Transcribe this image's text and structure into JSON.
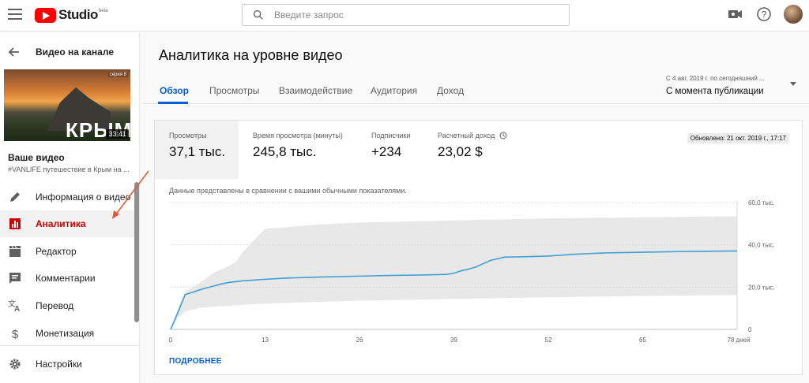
{
  "header": {
    "studio_word": "Studio",
    "beta": "beta",
    "search_placeholder": "Введите запрос",
    "icons": [
      "menu-icon",
      "youtube-logo",
      "search-icon",
      "create-video-icon",
      "help-icon",
      "avatar"
    ]
  },
  "sidebar": {
    "back_label": "Видео на канале",
    "thumbnail": {
      "series_tag": "серия 8",
      "overlay_text": "КРЫМ",
      "duration": "33:41"
    },
    "video_title": "Ваше видео",
    "video_subtitle": "#VANLIFE путешествие в Крым на ...",
    "items": [
      {
        "label": "Информация о видео",
        "icon": "pencil-icon"
      },
      {
        "label": "Аналитика",
        "icon": "analytics-icon",
        "active": true
      },
      {
        "label": "Редактор",
        "icon": "clapperboard-icon"
      },
      {
        "label": "Комментарии",
        "icon": "comment-icon"
      },
      {
        "label": "Перевод",
        "icon": "translate-icon"
      },
      {
        "label": "Монетизация",
        "icon": "dollar-icon"
      },
      {
        "label": "Настройки",
        "icon": "gear-icon"
      }
    ]
  },
  "main": {
    "title": "Аналитика на уровне видео",
    "tabs": [
      {
        "label": "Обзор",
        "active": true
      },
      {
        "label": "Просмотры"
      },
      {
        "label": "Взаимодействие"
      },
      {
        "label": "Аудитория"
      },
      {
        "label": "Доход"
      }
    ],
    "range_caption": "С 4 авг. 2019 г. по сегодняшний ...",
    "range_value": "С момента публикации",
    "metrics": [
      {
        "label": "Просмотры",
        "value": "37,1 тыс.",
        "selected": true
      },
      {
        "label": "Время просмотра (минуты)",
        "value": "245,8 тыс."
      },
      {
        "label": "Подписчики",
        "value": "+234"
      },
      {
        "label": "Расчетный доход",
        "value": "23,02 $",
        "info_icon": "info-icon"
      }
    ],
    "updated": "Обновлено: 21 окт. 2019 г., 17:17",
    "note": "Данные представлены в сравнении с вашими обычными показателями.",
    "more_link": "ПОДРОБНЕЕ"
  },
  "chart_data": {
    "type": "line",
    "x_ticks": [
      "0",
      "13",
      "26",
      "39",
      "52",
      "65",
      "78 дней"
    ],
    "y_ticks": [
      "0",
      "20,0 тыс.",
      "40,0 тыс.",
      "60,0 тыс."
    ],
    "xlim": [
      0,
      78
    ],
    "ylim": [
      0,
      60000
    ],
    "grid": true,
    "series": [
      {
        "color": "#3ea0d5",
        "x": [
          0,
          1,
          2,
          3,
          4,
          5,
          6,
          7,
          8,
          10,
          13,
          16,
          20,
          26,
          30,
          34,
          38,
          39,
          40,
          41,
          42,
          43,
          44,
          46,
          48,
          52,
          56,
          60,
          65,
          70,
          78
        ],
        "y": [
          0,
          8000,
          16500,
          17500,
          18700,
          19700,
          20600,
          21500,
          22200,
          23000,
          23700,
          24300,
          24700,
          25200,
          25500,
          25700,
          26000,
          26600,
          27700,
          28500,
          29500,
          31000,
          32600,
          34200,
          34300,
          34700,
          35600,
          36200,
          36500,
          36800,
          37100
        ]
      }
    ],
    "typical_range": {
      "color": "#e8e8e8",
      "x": [
        0,
        1,
        2,
        4,
        6,
        8,
        9,
        10,
        13,
        20,
        26,
        39,
        52,
        65,
        78
      ],
      "upper": [
        0,
        10000,
        18000,
        22000,
        27000,
        30000,
        32000,
        37000,
        47500,
        49500,
        50500,
        51500,
        52500,
        53000,
        53500
      ],
      "lower": [
        0,
        5500,
        8500,
        10200,
        10800,
        11200,
        11400,
        11700,
        12200,
        13000,
        13600,
        14400,
        15200,
        15800,
        16300
      ]
    }
  }
}
